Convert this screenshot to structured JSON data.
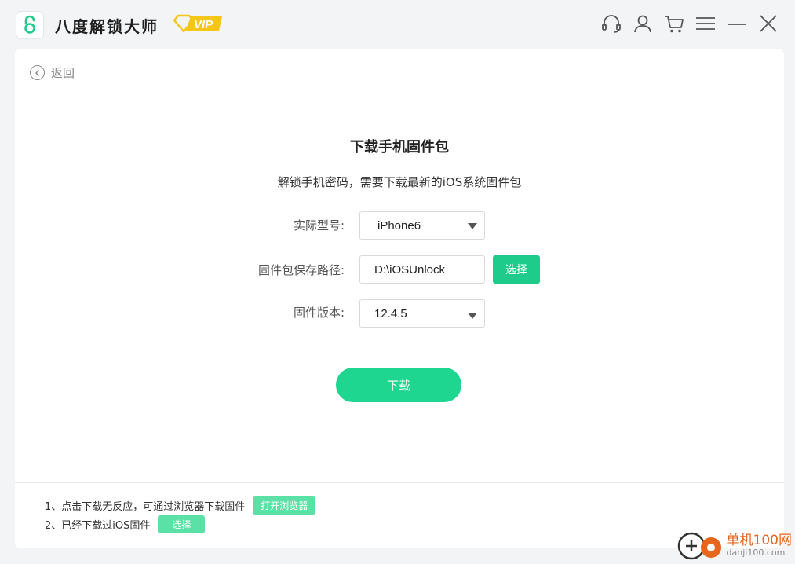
{
  "app": {
    "title": "八度解锁大师",
    "vip_label": "VIP",
    "accent_color": "#1ecb8a",
    "vip_color": "#f5c518"
  },
  "window_controls": [
    "headset-icon",
    "user-icon",
    "cart-icon",
    "menu-icon",
    "minimize-icon",
    "close-icon"
  ],
  "nav": {
    "back_label": "返回"
  },
  "main": {
    "heading": "下载手机固件包",
    "subheading": "解锁手机密码，需要下载最新的iOS系统固件包"
  },
  "form": {
    "model_label": "实际型号:",
    "model_value": "iPhone6",
    "path_label": "固件包保存路径:",
    "path_value": "D:\\iOSUnlock",
    "choose_label": "选择",
    "version_label": "固件版本:",
    "version_value": "12.4.5"
  },
  "download_label": "下载",
  "tips": [
    {
      "text": "1、点击下载无反应，可通过浏览器下载固件",
      "button": "打开浏览器"
    },
    {
      "text": "2、已经下载过iOS固件",
      "button": "选择"
    }
  ],
  "watermark": {
    "main": "单机100网",
    "sub": "danji100.com"
  }
}
